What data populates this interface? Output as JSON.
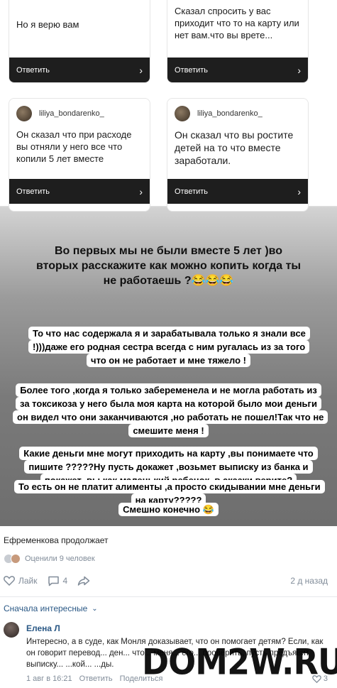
{
  "story": {
    "cards": [
      {
        "username": "",
        "question": "Но я верю вам",
        "reply": "Ответить"
      },
      {
        "username": "",
        "question": "Сказал спросить у вас приходит что то на карту или нет вам.что вы врете...",
        "reply": "Ответить"
      },
      {
        "username": "liliya_bondarenko_",
        "question": "Он сказал что при расходе вы отняли у него все что копили 5 лет вместе",
        "reply": "Ответить"
      },
      {
        "username": "liliya_bondarenko_",
        "question": "Он сказал что вы ростите детей на то что вместе заработали.",
        "reply": "Ответить"
      }
    ],
    "heading": "Во первых мы не были вместе 5 лет )во вторых расскажите как можно копить когда ты не работаешь ?😂😂😂",
    "bubbles": [
      "То что нас содержала я и зарабатывала только я знали все !)))даже его родная сестра всегда с ним ругалась из за того что он не работает и мне тяжело !",
      "Более того ,когда я только забеременела и не могла работать из за токсикоза  у него была моя карта на которой было мои деньги он видел что они заканчиваются ,но работать не пошел!Так что не смешите меня !",
      "Какие деньги мне могут приходить на карту ,вы понимаете что пишите ?????Ну пусть докажет ,возьмет выписку из банка и покажет ,вы как маленький ребенок ,в сказки верите?",
      "То есть он не платит алименты ,а  просто скидывании мне деньги на карту?????",
      "Смешно конечно 😂"
    ]
  },
  "post": {
    "caption": "Ефременкова продолжает",
    "rated": "Оценили 9 человек",
    "like_label": "Лайк",
    "comments_count": "4",
    "time": "2 д назад"
  },
  "sort_label": "Сначала интересные",
  "comment": {
    "author": "Елена Л",
    "text": "Интересно, а в суде, как Монля доказывает, что он помогает детям? Если, как он говорит перевод... ден... что... меня... его... проверить, пусть предъявит выписку... ...кой... ...ды.",
    "date": "1 авг в 16:21",
    "reply": "Ответить",
    "share": "Поделиться",
    "likes": "3"
  },
  "watermark": "DOM2W.RU",
  "colors": {
    "link": "#2a5885",
    "meta": "#818c99"
  }
}
